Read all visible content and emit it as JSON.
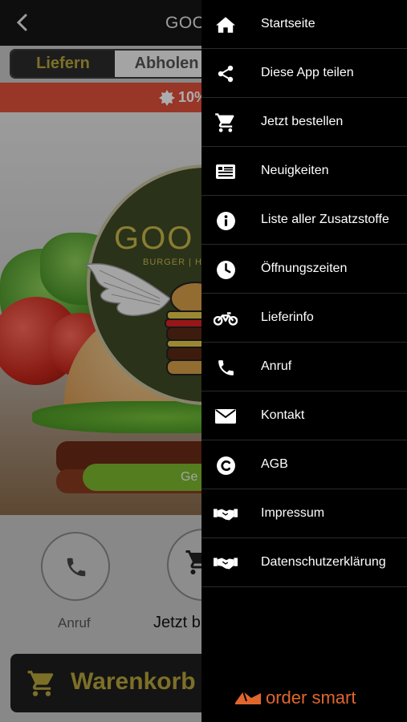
{
  "app": {
    "title": "GOOD",
    "tabs": {
      "deliver": "Liefern",
      "pickup": "Abholen"
    },
    "promo": "10%",
    "logo": {
      "name": "GOO",
      "tagline": "BURGER | HOT"
    },
    "hero_button": "Ge",
    "actions": {
      "call": "Anruf",
      "order": "Jetzt b"
    },
    "cart": "Warenkorb"
  },
  "menu": {
    "items": [
      {
        "label": "Startseite",
        "icon": "home-icon"
      },
      {
        "label": "Diese App teilen",
        "icon": "share-icon"
      },
      {
        "label": "Jetzt bestellen",
        "icon": "cart-icon"
      },
      {
        "label": "Neuigkeiten",
        "icon": "news-icon"
      },
      {
        "label": "Liste aller Zusatzstoffe",
        "icon": "info-icon"
      },
      {
        "label": "Öffnungszeiten",
        "icon": "clock-icon"
      },
      {
        "label": "Lieferinfo",
        "icon": "motorcycle-icon"
      },
      {
        "label": "Anruf",
        "icon": "phone-icon"
      },
      {
        "label": "Kontakt",
        "icon": "mail-icon"
      },
      {
        "label": "AGB",
        "icon": "copyright-icon"
      },
      {
        "label": "Impressum",
        "icon": "handshake-icon"
      },
      {
        "label": "Datenschutzerklärung",
        "icon": "handshake-icon"
      }
    ],
    "brand": "order smart"
  },
  "colors": {
    "accent_gold": "#b7a53b",
    "promo_red": "#e0503a",
    "brand_orange": "#e0662d",
    "drawer_bg": "#000000"
  }
}
